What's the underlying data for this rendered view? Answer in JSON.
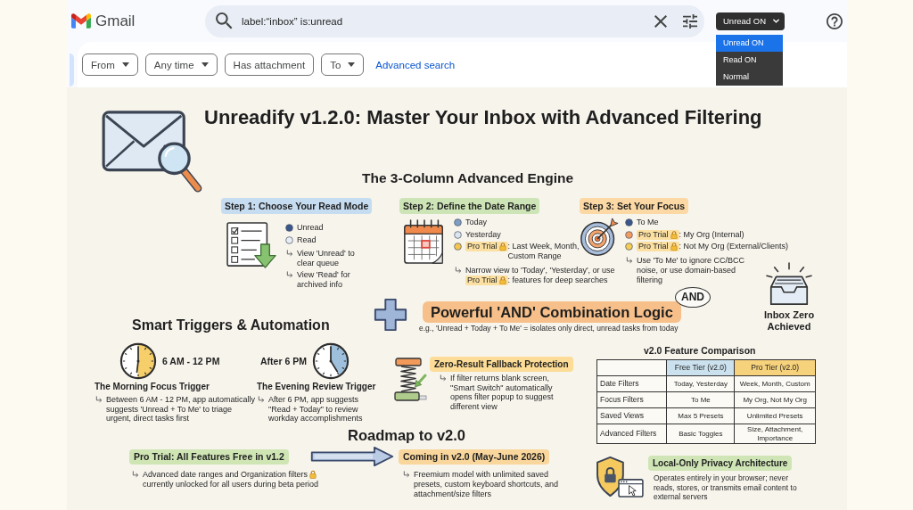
{
  "gmail": {
    "logo_text": "Gmail",
    "search": {
      "value": "label:“inbox” is:unread"
    },
    "mode_select": {
      "value": "Unread ON",
      "expanded": true,
      "options": [
        {
          "label": "Unread ON",
          "selected": true
        },
        {
          "label": "Read ON",
          "selected": false
        },
        {
          "label": "Normal",
          "selected": false
        }
      ]
    },
    "filters": [
      {
        "label": "From",
        "dropdown": true
      },
      {
        "label": "Any time",
        "dropdown": true
      },
      {
        "label": "Has attachment",
        "dropdown": false
      },
      {
        "label": "To",
        "dropdown": true
      }
    ],
    "advanced_search": "Advanced search"
  },
  "poster": {
    "title": "Unreadify v1.2.0: Master Your Inbox with Advanced Filtering",
    "engine": {
      "heading": "The 3-Column Advanced Engine",
      "steps": [
        {
          "kind": "checklist",
          "label": "Step 1: Choose Your Read Mode",
          "color": "#c6dcf0",
          "options": [
            {
              "text": "Unread",
              "locked": false,
              "color": "#3a568a"
            },
            {
              "text": "Read",
              "locked": false,
              "color": "#e8edf3"
            }
          ],
          "notes": [
            {
              "text": "View 'Unread' to clear queue",
              "locked": false
            },
            {
              "text": "View 'Read' for archived info",
              "locked": false
            }
          ]
        },
        {
          "kind": "calendar",
          "label": "Step 2: Define the Date Range",
          "color": "#cde4b6",
          "options": [
            {
              "text": "Today",
              "locked": false,
              "color": "#7d9dc2"
            },
            {
              "text": "Yesterday",
              "locked": false,
              "color": "#dce4ee"
            },
            {
              "tag": "Pro Trial",
              "locked": true,
              "suffix": ": Last Week, Month, Custom Range",
              "color": "#f5c54f"
            }
          ],
          "notes": [
            {
              "text": "Narrow view to 'Today', 'Yesterday', or use",
              "tag": "Pro Trial",
              "locked": true,
              "suffix": ": features for deep searches"
            }
          ]
        },
        {
          "kind": "target",
          "label": "Step 3: Set Your Focus",
          "color": "#fbd8a4",
          "options": [
            {
              "text": "To Me",
              "locked": false,
              "color": "#3a568a"
            },
            {
              "tag": "Pro Trial",
              "locked": true,
              "suffix": ": My Org (Internal)",
              "color": "#f19b63"
            },
            {
              "tag": "Pro Trial",
              "locked": true,
              "suffix": ": Not My Org (External/Clients)",
              "color": "#f5cc55"
            }
          ],
          "notes": [
            {
              "text": "Use 'To Me' to ignore CC/BCC noise, or use domain-based filtering",
              "locked": false
            }
          ]
        }
      ]
    },
    "inbox_zero": "Inbox Zero Achieved",
    "triggers": {
      "heading": "Smart Triggers & Automation",
      "items": [
        {
          "kind": "morning",
          "time": "6 AM - 12 PM",
          "title": "The Morning Focus Trigger",
          "note": "Between 6 AM - 12 PM, app automatically suggests 'Unread + To Me' to triage urgent, direct tasks first"
        },
        {
          "kind": "evening",
          "time": "After 6 PM",
          "title": "The Evening Review Trigger",
          "note": "After 6 PM, app suggests \"Read + Today\" to review workday accomplishments"
        }
      ]
    },
    "combination": {
      "heading": "Powerful 'AND' Combination Logic",
      "bubble": "AND",
      "example": "e.g., 'Unread + Today + To Me' = isolates only direct, unread tasks from today"
    },
    "fallback": {
      "heading": "Zero-Result Fallback Protection",
      "note": "If filter returns blank screen, \"Smart Switch\" automatically opens filter popup to suggest different view"
    },
    "roadmap": {
      "heading": "Roadmap to v2.0",
      "stages": [
        {
          "label": "Pro Trial: All Features Free in v1.2",
          "color": "#cfe5b4",
          "note": {
            "text": "Advanced date ranges and Organization filters",
            "locked": true,
            "suffix": "currently unlocked for all users during beta period"
          }
        },
        {
          "label": "Coming in v2.0 (May-June 2026)",
          "color": "#f9d69c",
          "note": {
            "text": "Freemium model with unlimited saved presets, custom keyboard shortcuts, and attachment/size filters",
            "locked": false
          }
        }
      ]
    },
    "comparison": {
      "title": "v2.0 Feature Comparison",
      "columns": [
        {
          "label": "Free Tier (v2.0)",
          "color": "#cbe1ee"
        },
        {
          "label": "Pro Tier (v2.0)",
          "color": "#f7d27c"
        }
      ],
      "rows": [
        {
          "feature": "Date Filters",
          "values": [
            "Today, Yesterday",
            "Week, Month, Custom"
          ]
        },
        {
          "feature": "Focus Filters",
          "values": [
            "To Me",
            "My Org, Not My Org"
          ]
        },
        {
          "feature": "Saved Views",
          "values": [
            "Max 5 Presets",
            "Unlimited Presets"
          ]
        },
        {
          "feature": "Advanced Filters",
          "values": [
            "Basic Toggles",
            "Size, Attachment, Importance"
          ]
        }
      ]
    },
    "privacy": {
      "heading": "Local-Only Privacy Architecture",
      "text": "Operates entirely in your browser; never reads, stores, or transmits email content to external servers"
    }
  }
}
